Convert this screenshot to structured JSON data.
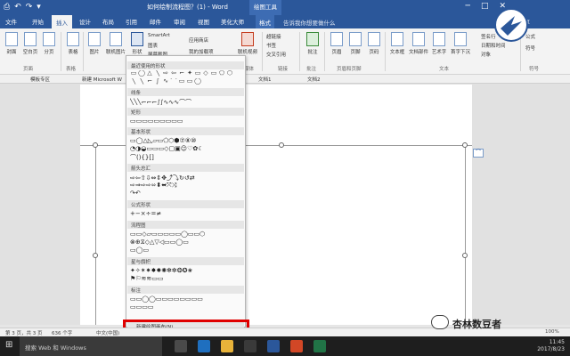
{
  "titlebar": {
    "title": "如何绘制流程图？(1) - Word",
    "context_tab": "绘图工具",
    "qat": [
      "⎙",
      "↶",
      "↷",
      "▾"
    ],
    "win_buttons": [
      "─",
      "□",
      "✕"
    ]
  },
  "tabs": {
    "items": [
      "文件",
      "开始",
      "插入",
      "设计",
      "布局",
      "引用",
      "邮件",
      "审阅",
      "视图",
      "美化大师",
      "格式"
    ],
    "active": "插入",
    "tell_me": "告诉我你想要做什么",
    "share": "共享"
  },
  "ribbon": {
    "buttons": [
      {
        "label": "封面"
      },
      {
        "label": "空白页"
      },
      {
        "label": "分页"
      },
      {
        "label": "表格"
      },
      {
        "label": "图片"
      },
      {
        "label": "联机图片"
      },
      {
        "label": "形状"
      },
      {
        "label": "联机视频"
      },
      {
        "label": "链接"
      },
      {
        "label": "批注"
      },
      {
        "label": "页眉"
      },
      {
        "label": "页脚"
      },
      {
        "label": "页码"
      },
      {
        "label": "文本框"
      },
      {
        "label": "文档部件"
      },
      {
        "label": "艺术字"
      },
      {
        "label": "首字下沉"
      },
      {
        "label": "Ω"
      }
    ],
    "small": {
      "smartart": "SmartArt",
      "chart": "图表",
      "screenshot": "屏幕截图",
      "store": "应用商店",
      "myaddins": "我的加载项",
      "hyperlink": "超链接",
      "bookmark": "书签",
      "crossref": "交叉引用",
      "signature": "签名行",
      "datetime": "日期和时间",
      "object": "对象",
      "formula": "公式",
      "symbol": "符号"
    },
    "groups": {
      "pages": "页面",
      "tables": "表格",
      "media": "媒体",
      "links": "链接",
      "comments": "批注",
      "headerfooter": "页眉和页脚",
      "text": "文本",
      "symbols": "符号"
    }
  },
  "doctabs": {
    "items": [
      "模板专区",
      "新建 Microsoft W",
      "文档1",
      "文档2"
    ]
  },
  "dropdown": {
    "top_label": "最近使用的形状",
    "sections": [
      {
        "name": "线条",
        "rows": [
          "╲╲╲⌐⌐⌐∫∫∿∿∿⌒⌒"
        ]
      },
      {
        "name": "矩形",
        "rows": [
          "▭▭▭▭▭▭▭▭▭"
        ]
      },
      {
        "name": "基本形状",
        "rows": [
          "▭◯△◺▱▭⬠⬡⬢⑦⑧⑩",
          "◔◑◒▭▭▭◇▢▣☺♡✿☾",
          "⌒(){}[]"
        ]
      },
      {
        "name": "箭头总汇",
        "rows": [
          "⇨⇦⇧⇩⇔⇕✥⤴⤵↻↺⇄",
          "⇨⇒⇨⇨⬄⬍⬌⤧⤨",
          "↷↶"
        ]
      },
      {
        "name": "公式形状",
        "rows": [
          "+−×÷=≠"
        ]
      },
      {
        "name": "流程图",
        "rows": [
          "▭▭◇▱▭▭▭▭▭◯▭▭⬡",
          "⊗⊕⧖◇△▽◁▭▭◯▭",
          "▭◯▭"
        ]
      },
      {
        "name": "星与旗帜",
        "rows": [
          "✦✧✶✷✸✹✺✻✼❂✪✬",
          "⚑⚐≋≋▭▭"
        ]
      },
      {
        "name": "标注",
        "rows": [
          "▭▭◯◯▭▭▭▭▭▭▭▭",
          "▭▭▭▭"
        ]
      }
    ],
    "new_canvas": "新建绘图画布(N)"
  },
  "statusbar": {
    "page": "第 3 页，共 3 页",
    "words": "636 个字",
    "lang": "中文(中国)",
    "zoom": "100%"
  },
  "taskbar": {
    "search": "搜索 Web 和 Windows",
    "time": "11:45",
    "date": "2017/8/23"
  },
  "watermark": "杏林数豆者",
  "colors": {
    "brand": "#2b579a",
    "highlight": "#e00000"
  }
}
